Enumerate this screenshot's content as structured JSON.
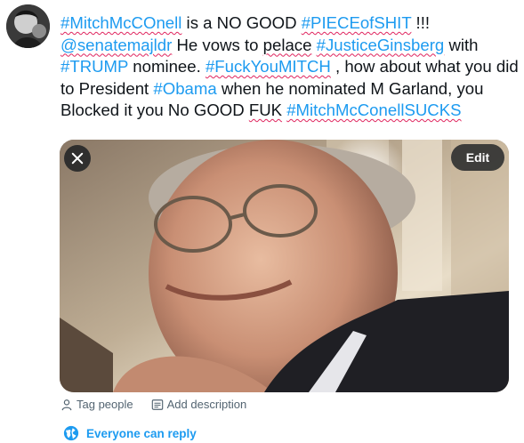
{
  "tweet": {
    "segments": [
      {
        "text": "#MitchMcCOnell",
        "kind": "hashtag",
        "spell": true
      },
      {
        "text": " is a NO GOOD ",
        "kind": "plain",
        "spell": false
      },
      {
        "text": "#PIECEofSHIT",
        "kind": "hashtag",
        "spell": true
      },
      {
        "text": " !!! ",
        "kind": "plain",
        "spell": false
      },
      {
        "text": "@senatemajldr",
        "kind": "mention",
        "spell": true
      },
      {
        "text": " He vows to ",
        "kind": "plain",
        "spell": false
      },
      {
        "text": "pelace",
        "kind": "plain",
        "spell": true
      },
      {
        "text": " ",
        "kind": "plain",
        "spell": false
      },
      {
        "text": "#JusticeGinsberg",
        "kind": "hashtag",
        "spell": true
      },
      {
        "text": " with ",
        "kind": "plain",
        "spell": false
      },
      {
        "text": "#TRUMP",
        "kind": "hashtag",
        "spell": false
      },
      {
        "text": " nominee. ",
        "kind": "plain",
        "spell": false
      },
      {
        "text": "#FuckYouMITCH",
        "kind": "hashtag",
        "spell": true
      },
      {
        "text": " , how about what you did to President ",
        "kind": "plain",
        "spell": false
      },
      {
        "text": "#Obama",
        "kind": "hashtag",
        "spell": false
      },
      {
        "text": " when he nominated M Garland, you Blocked it you No GOOD ",
        "kind": "plain",
        "spell": false
      },
      {
        "text": "FUK",
        "kind": "plain",
        "spell": true
      },
      {
        "text": " ",
        "kind": "plain",
        "spell": false
      },
      {
        "text": "#MitchMcConellSUCKS",
        "kind": "hashtag",
        "spell": true
      }
    ]
  },
  "media": {
    "edit_label": "Edit",
    "close_icon": "close-icon"
  },
  "actions": {
    "tag_people": "Tag people",
    "add_description": "Add description"
  },
  "reply_setting": {
    "label": "Everyone can reply",
    "icon": "globe-icon"
  },
  "colors": {
    "accent": "#1d9bf0",
    "text": "#0f1419",
    "muted": "#536471",
    "spellcheck": "#e0245e"
  }
}
